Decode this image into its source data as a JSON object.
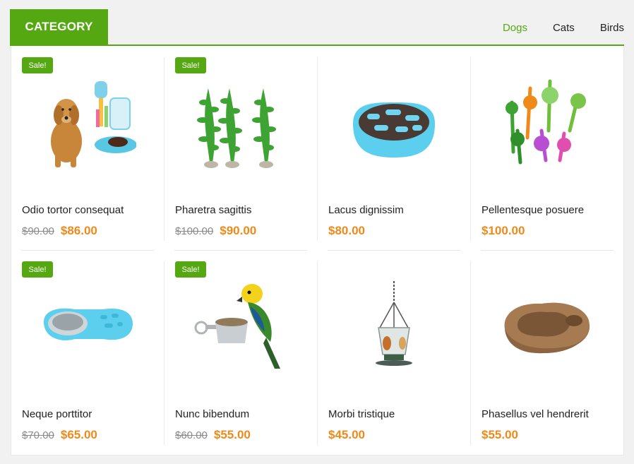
{
  "header": {
    "title": "CATEGORY",
    "filters": [
      "Dogs",
      "Cats",
      "Birds"
    ],
    "active_filter": "Dogs"
  },
  "colors": {
    "accent": "#56a812",
    "price": "#ef8a1a",
    "old_price": "#8a8a8a"
  },
  "products": [
    {
      "name": "Odio tortor consequat",
      "old_price": "$90.00",
      "price": "$86.00",
      "sale": "Sale!",
      "icon": "dog-water-feeder-icon"
    },
    {
      "name": "Pharetra sagittis",
      "old_price": "$100.00",
      "price": "$90.00",
      "sale": "Sale!",
      "icon": "aquarium-plants-icon"
    },
    {
      "name": "Lacus dignissim",
      "old_price": "",
      "price": "$80.00",
      "sale": "",
      "icon": "slow-feeder-bowl-icon"
    },
    {
      "name": "Pellentesque posuere",
      "old_price": "",
      "price": "$100.00",
      "sale": "",
      "icon": "colorful-aquarium-plants-icon"
    },
    {
      "name": "Neque porttitor",
      "old_price": "$70.00",
      "price": "$65.00",
      "sale": "Sale!",
      "icon": "double-pet-bowl-icon"
    },
    {
      "name": "Nunc bibendum",
      "old_price": "$60.00",
      "price": "$55.00",
      "sale": "Sale!",
      "icon": "parrot-feeder-cup-icon"
    },
    {
      "name": "Morbi tristique",
      "old_price": "",
      "price": "$45.00",
      "sale": "",
      "icon": "hanging-bird-feeder-icon"
    },
    {
      "name": "Phasellus vel hendrerit",
      "old_price": "",
      "price": "$55.00",
      "sale": "",
      "icon": "reptile-rock-dish-icon"
    }
  ]
}
